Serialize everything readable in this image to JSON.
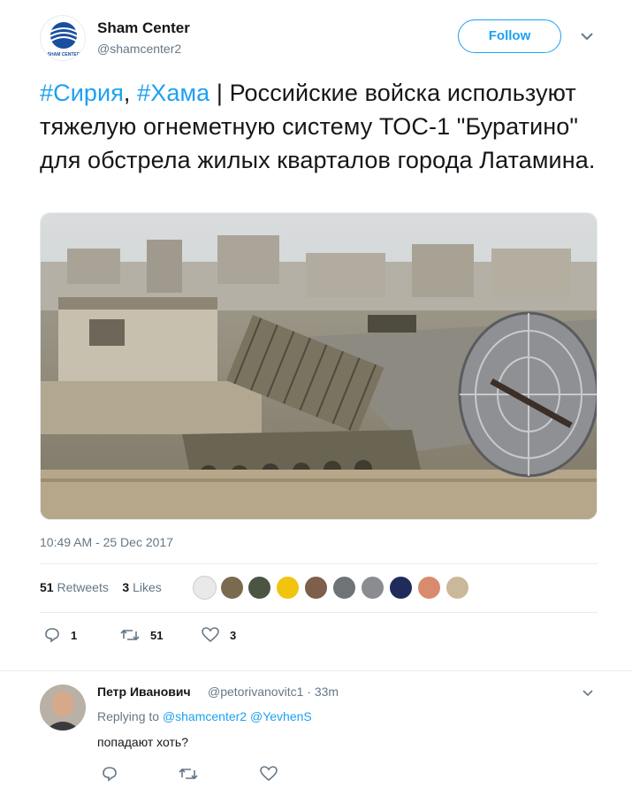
{
  "account": {
    "name": "Sham Center",
    "handle": "@shamcenter2",
    "logo_text": "SHAM CENTER",
    "follow_label": "Follow"
  },
  "tweet": {
    "hashtag1": "#Сирия",
    "sep": ", ",
    "hashtag2": "#Хама",
    "body": " | Российские войска используют тяжелую огнеметную систему ТОС-1 \"Буратино\" для обстрела жилых кварталов города Латамина.",
    "timestamp": "10:49 AM - 25 Dec 2017",
    "retweets_count": "51",
    "retweets_label": "Retweets",
    "likes_count": "3",
    "likes_label": "Likes",
    "actions": {
      "replies": "1",
      "retweets": "51",
      "likes": "3"
    }
  },
  "reply": {
    "name": "Петр Иванович",
    "handle": "@petorivanovitc1 · 33m",
    "replying_prefix": "Replying to",
    "replying_to1": "@shamcenter2",
    "replying_to2": "@YevhenS",
    "text": "попадают хоть?"
  },
  "colors": {
    "accent": "#1da1f2",
    "muted": "#657786",
    "text": "#14171a",
    "border": "#e6ecf0"
  },
  "icons": [
    "chevron-down-icon",
    "reply-icon",
    "retweet-icon",
    "like-icon"
  ]
}
